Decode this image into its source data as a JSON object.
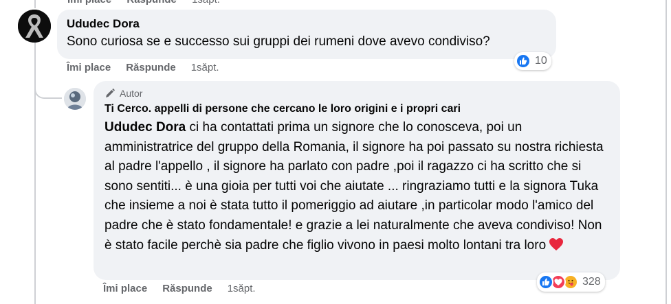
{
  "previous_comment": {
    "like_label": "Îmi place",
    "reply_label": "Răspunde",
    "time": "1săpt."
  },
  "comment": {
    "author": "Ududec Dora",
    "text": "Sono curiosa se e successo sui gruppi dei rumeni dove avevo condiviso?",
    "reaction_count": "10",
    "reaction_icons": [
      "like-icon"
    ],
    "like_label": "Îmi place",
    "reply_label": "Răspunde",
    "time": "1săpt."
  },
  "reply": {
    "badge": "Autor",
    "author": "Ti Cerco. appelli di persone che cercano le loro origini e i propri cari",
    "mention": "Ududec Dora",
    "text": " ci ha contattati prima un signore che lo conosceva, poi un amministratrice del gruppo della Romania, il signore ha poi passato su nostra richiesta al padre l'appello , il signore ha parlato con padre ,poi il ragazzo ci ha scritto che si sono sentiti... è una gioia per tutti voi che aiutate ... ringraziamo tutti e la signora Tuka che insieme a noi è stata tutto il pomeriggio ad aiutare ,in particolar modo l'amico del padre che è stato fondamentale! e grazie a lei naturalmente che aveva condiviso! Non è stato facile perchè sia padre che figlio vivono in paesi molto lontani tra loro",
    "emoji_icon": "red-heart-icon",
    "reaction_count": "328",
    "reaction_icons": [
      "like-icon",
      "love-icon",
      "care-icon"
    ],
    "like_label": "Îmi place",
    "reply_label": "Răspunde",
    "time": "1săpt."
  },
  "colors": {
    "like_blue": "#1877f2",
    "love_red": "#f33e58",
    "care_yellow": "#f7b125",
    "bubble_bg": "#f0f2f5",
    "meta_gray": "#65676b"
  }
}
